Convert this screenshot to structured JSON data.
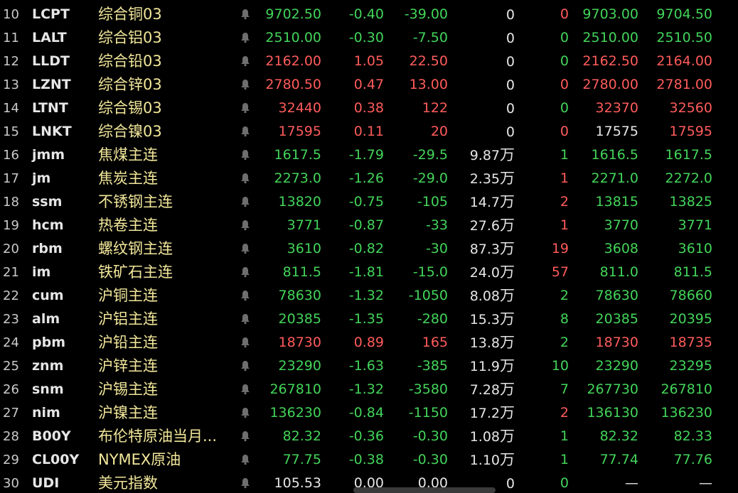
{
  "colors": {
    "up": "#ff5b5b",
    "down": "#43d45a",
    "flat": "#e6e6e6",
    "name": "#f2e79a",
    "background": "#000000"
  },
  "icons": {
    "alert": "bell-icon"
  },
  "rows": [
    {
      "idx": "10",
      "code": "LCPT",
      "name": "综合铜03",
      "price": "9702.50",
      "chg": "-0.40",
      "chgv": "-39.00",
      "vol": "0",
      "vol_unit": "",
      "cur": "0",
      "bid": "9703.00",
      "ask": "9704.50",
      "c_price": "down",
      "c_chg": "down",
      "c_chgv": "down",
      "c_cur": "up",
      "c_bid": "down",
      "c_ask": "down"
    },
    {
      "idx": "11",
      "code": "LALT",
      "name": "综合铝03",
      "price": "2510.00",
      "chg": "-0.30",
      "chgv": "-7.50",
      "vol": "0",
      "vol_unit": "",
      "cur": "0",
      "bid": "2510.00",
      "ask": "2510.50",
      "c_price": "down",
      "c_chg": "down",
      "c_chgv": "down",
      "c_cur": "down",
      "c_bid": "down",
      "c_ask": "down"
    },
    {
      "idx": "12",
      "code": "LLDT",
      "name": "综合铅03",
      "price": "2162.00",
      "chg": "1.05",
      "chgv": "22.50",
      "vol": "0",
      "vol_unit": "",
      "cur": "0",
      "bid": "2162.50",
      "ask": "2164.00",
      "c_price": "up",
      "c_chg": "up",
      "c_chgv": "up",
      "c_cur": "down",
      "c_bid": "up",
      "c_ask": "up"
    },
    {
      "idx": "13",
      "code": "LZNT",
      "name": "综合锌03",
      "price": "2780.50",
      "chg": "0.47",
      "chgv": "13.00",
      "vol": "0",
      "vol_unit": "",
      "cur": "0",
      "bid": "2780.00",
      "ask": "2781.00",
      "c_price": "up",
      "c_chg": "up",
      "c_chgv": "up",
      "c_cur": "up",
      "c_bid": "up",
      "c_ask": "up"
    },
    {
      "idx": "14",
      "code": "LTNT",
      "name": "综合锡03",
      "price": "32440",
      "chg": "0.38",
      "chgv": "122",
      "vol": "0",
      "vol_unit": "",
      "cur": "0",
      "bid": "32370",
      "ask": "32560",
      "c_price": "up",
      "c_chg": "up",
      "c_chgv": "up",
      "c_cur": "down",
      "c_bid": "up",
      "c_ask": "up"
    },
    {
      "idx": "15",
      "code": "LNKT",
      "name": "综合镍03",
      "price": "17595",
      "chg": "0.11",
      "chgv": "20",
      "vol": "0",
      "vol_unit": "",
      "cur": "0",
      "bid": "17575",
      "ask": "17595",
      "c_price": "up",
      "c_chg": "up",
      "c_chgv": "up",
      "c_cur": "up",
      "c_bid": "flat",
      "c_ask": "up"
    },
    {
      "idx": "16",
      "code": "jmm",
      "name": "焦煤主连",
      "price": "1617.5",
      "chg": "-1.79",
      "chgv": "-29.5",
      "vol": "9.87",
      "vol_unit": "万",
      "cur": "1",
      "bid": "1616.5",
      "ask": "1617.5",
      "c_price": "down",
      "c_chg": "down",
      "c_chgv": "down",
      "c_cur": "down",
      "c_bid": "down",
      "c_ask": "down"
    },
    {
      "idx": "17",
      "code": "jm",
      "name": "焦炭主连",
      "price": "2273.0",
      "chg": "-1.26",
      "chgv": "-29.0",
      "vol": "2.35",
      "vol_unit": "万",
      "cur": "1",
      "bid": "2271.0",
      "ask": "2272.0",
      "c_price": "down",
      "c_chg": "down",
      "c_chgv": "down",
      "c_cur": "up",
      "c_bid": "down",
      "c_ask": "down"
    },
    {
      "idx": "18",
      "code": "ssm",
      "name": "不锈钢主连",
      "price": "13820",
      "chg": "-0.75",
      "chgv": "-105",
      "vol": "14.7",
      "vol_unit": "万",
      "cur": "2",
      "bid": "13815",
      "ask": "13825",
      "c_price": "down",
      "c_chg": "down",
      "c_chgv": "down",
      "c_cur": "up",
      "c_bid": "down",
      "c_ask": "down"
    },
    {
      "idx": "19",
      "code": "hcm",
      "name": "热卷主连",
      "price": "3771",
      "chg": "-0.87",
      "chgv": "-33",
      "vol": "27.6",
      "vol_unit": "万",
      "cur": "1",
      "bid": "3770",
      "ask": "3771",
      "c_price": "down",
      "c_chg": "down",
      "c_chgv": "down",
      "c_cur": "up",
      "c_bid": "down",
      "c_ask": "down"
    },
    {
      "idx": "20",
      "code": "rbm",
      "name": "螺纹钢主连",
      "price": "3610",
      "chg": "-0.82",
      "chgv": "-30",
      "vol": "87.3",
      "vol_unit": "万",
      "cur": "19",
      "bid": "3608",
      "ask": "3610",
      "c_price": "down",
      "c_chg": "down",
      "c_chgv": "down",
      "c_cur": "up",
      "c_bid": "down",
      "c_ask": "down"
    },
    {
      "idx": "21",
      "code": "im",
      "name": "铁矿石主连",
      "price": "811.5",
      "chg": "-1.81",
      "chgv": "-15.0",
      "vol": "24.0",
      "vol_unit": "万",
      "cur": "57",
      "bid": "811.0",
      "ask": "811.5",
      "c_price": "down",
      "c_chg": "down",
      "c_chgv": "down",
      "c_cur": "up",
      "c_bid": "down",
      "c_ask": "down"
    },
    {
      "idx": "22",
      "code": "cum",
      "name": "沪铜主连",
      "price": "78630",
      "chg": "-1.32",
      "chgv": "-1050",
      "vol": "8.08",
      "vol_unit": "万",
      "cur": "2",
      "bid": "78630",
      "ask": "78660",
      "c_price": "down",
      "c_chg": "down",
      "c_chgv": "down",
      "c_cur": "down",
      "c_bid": "down",
      "c_ask": "down"
    },
    {
      "idx": "23",
      "code": "alm",
      "name": "沪铝主连",
      "price": "20385",
      "chg": "-1.35",
      "chgv": "-280",
      "vol": "15.3",
      "vol_unit": "万",
      "cur": "8",
      "bid": "20385",
      "ask": "20395",
      "c_price": "down",
      "c_chg": "down",
      "c_chgv": "down",
      "c_cur": "down",
      "c_bid": "down",
      "c_ask": "down"
    },
    {
      "idx": "24",
      "code": "pbm",
      "name": "沪铅主连",
      "price": "18730",
      "chg": "0.89",
      "chgv": "165",
      "vol": "13.8",
      "vol_unit": "万",
      "cur": "2",
      "bid": "18730",
      "ask": "18735",
      "c_price": "up",
      "c_chg": "up",
      "c_chgv": "up",
      "c_cur": "down",
      "c_bid": "up",
      "c_ask": "up"
    },
    {
      "idx": "25",
      "code": "znm",
      "name": "沪锌主连",
      "price": "23290",
      "chg": "-1.63",
      "chgv": "-385",
      "vol": "11.9",
      "vol_unit": "万",
      "cur": "10",
      "bid": "23290",
      "ask": "23295",
      "c_price": "down",
      "c_chg": "down",
      "c_chgv": "down",
      "c_cur": "down",
      "c_bid": "down",
      "c_ask": "down"
    },
    {
      "idx": "26",
      "code": "snm",
      "name": "沪锡主连",
      "price": "267810",
      "chg": "-1.32",
      "chgv": "-3580",
      "vol": "7.28",
      "vol_unit": "万",
      "cur": "7",
      "bid": "267730",
      "ask": "267810",
      "c_price": "down",
      "c_chg": "down",
      "c_chgv": "down",
      "c_cur": "down",
      "c_bid": "down",
      "c_ask": "down"
    },
    {
      "idx": "27",
      "code": "nim",
      "name": "沪镍主连",
      "price": "136230",
      "chg": "-0.84",
      "chgv": "-1150",
      "vol": "17.2",
      "vol_unit": "万",
      "cur": "2",
      "bid": "136130",
      "ask": "136230",
      "c_price": "down",
      "c_chg": "down",
      "c_chgv": "down",
      "c_cur": "up",
      "c_bid": "down",
      "c_ask": "down"
    },
    {
      "idx": "28",
      "code": "B00Y",
      "name": "布伦特原油当月...",
      "price": "82.32",
      "chg": "-0.36",
      "chgv": "-0.30",
      "vol": "1.08",
      "vol_unit": "万",
      "cur": "1",
      "bid": "82.32",
      "ask": "82.33",
      "c_price": "down",
      "c_chg": "down",
      "c_chgv": "down",
      "c_cur": "down",
      "c_bid": "down",
      "c_ask": "down"
    },
    {
      "idx": "29",
      "code": "CL00Y",
      "name": "NYMEX原油",
      "price": "77.75",
      "chg": "-0.38",
      "chgv": "-0.30",
      "vol": "1.10",
      "vol_unit": "万",
      "cur": "1",
      "bid": "77.74",
      "ask": "77.76",
      "c_price": "down",
      "c_chg": "down",
      "c_chgv": "down",
      "c_cur": "down",
      "c_bid": "down",
      "c_ask": "down"
    },
    {
      "idx": "30",
      "code": "UDI",
      "name": "美元指数",
      "price": "105.53",
      "chg": "0.00",
      "chgv": "0.00",
      "vol": "0",
      "vol_unit": "",
      "cur": "0",
      "bid": "—",
      "ask": "—",
      "c_price": "flat",
      "c_chg": "flat",
      "c_chgv": "flat",
      "c_cur": "down",
      "c_bid": "flat",
      "c_ask": "flat"
    }
  ]
}
